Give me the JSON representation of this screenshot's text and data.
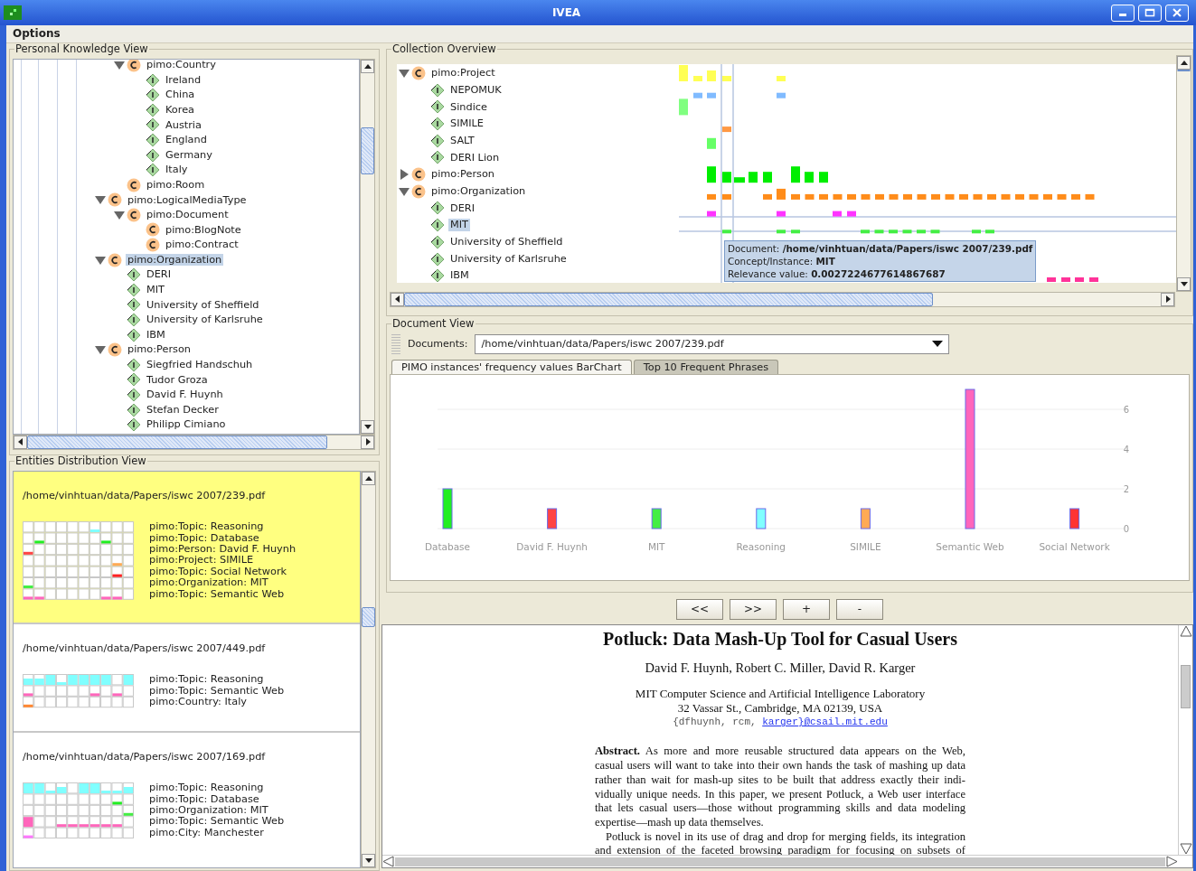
{
  "window": {
    "title": "IVEA"
  },
  "menu": [
    {
      "label": "Options"
    }
  ],
  "knowledge_view": {
    "title": "Personal Knowledge View",
    "tree": [
      {
        "kind": "group",
        "children": [
          {
            "kind": "concept",
            "label": "pimo:Country",
            "expanded": true,
            "selected": false,
            "children": [
              {
                "kind": "instance",
                "label": "Ireland",
                "selected": false
              },
              {
                "kind": "instance",
                "label": "China",
                "selected": false
              },
              {
                "kind": "instance",
                "label": "Korea",
                "selected": false
              },
              {
                "kind": "instance",
                "label": "Austria",
                "selected": false
              },
              {
                "kind": "instance",
                "label": "England",
                "selected": false
              },
              {
                "kind": "instance",
                "label": "Germany",
                "selected": false
              },
              {
                "kind": "instance",
                "label": "Italy",
                "selected": false
              }
            ]
          },
          {
            "kind": "concept",
            "label": "pimo:Room",
            "selected": false
          }
        ]
      },
      {
        "kind": "concept",
        "label": "pimo:LogicalMediaType",
        "expanded": true,
        "selected": false,
        "children": [
          {
            "kind": "concept",
            "label": "pimo:Document",
            "expanded": true,
            "selected": false,
            "children": [
              {
                "kind": "concept",
                "label": "pimo:BlogNote",
                "selected": false
              },
              {
                "kind": "concept",
                "label": "pimo:Contract",
                "selected": false
              }
            ]
          }
        ]
      },
      {
        "kind": "concept",
        "label": "pimo:Organization",
        "expanded": true,
        "selected": true,
        "children": [
          {
            "kind": "instance",
            "label": "DERI",
            "selected": false
          },
          {
            "kind": "instance",
            "label": "MIT",
            "selected": false
          },
          {
            "kind": "instance",
            "label": "University of Sheffield",
            "selected": false
          },
          {
            "kind": "instance",
            "label": "University of Karlsruhe",
            "selected": false
          },
          {
            "kind": "instance",
            "label": "IBM",
            "selected": false
          }
        ]
      },
      {
        "kind": "concept",
        "label": "pimo:Person",
        "expanded": true,
        "selected": false,
        "children": [
          {
            "kind": "instance",
            "label": "Siegfried Handschuh",
            "selected": false
          },
          {
            "kind": "instance",
            "label": "Tudor Groza",
            "selected": false
          },
          {
            "kind": "instance",
            "label": "David F. Huynh",
            "selected": false
          },
          {
            "kind": "instance",
            "label": "Stefan Decker",
            "selected": false
          },
          {
            "kind": "instance",
            "label": "Philipp Cimiano",
            "selected": false
          }
        ]
      }
    ]
  },
  "entities_view": {
    "title": "Entities Distribution View",
    "documents": [
      {
        "path": "/home/vinhtuan/data/Papers/iswc 2007/239.pdf",
        "selected": true,
        "entities": [
          {
            "label": "pimo:Topic: Reasoning",
            "color": "#80ffff"
          },
          {
            "label": "pimo:Topic: Database",
            "color": "#22ee22"
          },
          {
            "label": "pimo:Person: David F. Huynh",
            "color": "#ff4444"
          },
          {
            "label": "pimo:Project: SIMILE",
            "color": "#ffaa55"
          },
          {
            "label": "pimo:Topic: Social Network",
            "color": "#ff2222"
          },
          {
            "label": "pimo:Organization: MIT",
            "color": "#44ee44"
          },
          {
            "label": "pimo:Topic: Semantic Web",
            "color": "#ff66bb"
          }
        ]
      },
      {
        "path": "/home/vinhtuan/data/Papers/iswc 2007/449.pdf",
        "selected": false,
        "entities": [
          {
            "label": "pimo:Topic: Reasoning",
            "color": "#80ffff"
          },
          {
            "label": "pimo:Topic: Semantic Web",
            "color": "#ff66bb"
          },
          {
            "label": "pimo:Country: Italy",
            "color": "#ff8833"
          }
        ]
      },
      {
        "path": "/home/vinhtuan/data/Papers/iswc 2007/169.pdf",
        "selected": false,
        "entities": [
          {
            "label": "pimo:Topic: Reasoning",
            "color": "#80ffff"
          },
          {
            "label": "pimo:Topic: Database",
            "color": "#22ee22"
          },
          {
            "label": "pimo:Organization: MIT",
            "color": "#44ee44"
          },
          {
            "label": "pimo:Topic: Semantic Web",
            "color": "#ff66bb"
          },
          {
            "label": "pimo:City: Manchester",
            "color": "#ff77ff"
          }
        ]
      }
    ]
  },
  "collection_overview": {
    "title": "Collection Overview",
    "tree": [
      {
        "kind": "concept",
        "label": "pimo:Project",
        "expanded": true,
        "selected": false,
        "color": "#ffff55",
        "children": [
          {
            "kind": "instance",
            "label": "NEPOMUK",
            "selected": false,
            "color": "#80bbff"
          },
          {
            "kind": "instance",
            "label": "Sindice",
            "selected": false,
            "color": "#80ff80"
          },
          {
            "kind": "instance",
            "label": "SIMILE",
            "selected": false,
            "color": "#ff9944"
          },
          {
            "kind": "instance",
            "label": "SALT",
            "selected": false,
            "color": "#66ff66"
          },
          {
            "kind": "instance",
            "label": "DERI Lion",
            "selected": false
          }
        ]
      },
      {
        "kind": "concept",
        "label": "pimo:Person",
        "expanded": false,
        "selected": false,
        "color": "#00ee00"
      },
      {
        "kind": "concept",
        "label": "pimo:Organization",
        "expanded": true,
        "selected": false,
        "color": "#ff8c1a",
        "children": [
          {
            "kind": "instance",
            "label": "DERI",
            "selected": false,
            "color": "#ff33ff"
          },
          {
            "kind": "instance",
            "label": "MIT",
            "selected": true,
            "color": "#44ee44"
          },
          {
            "kind": "instance",
            "label": "University of Sheffield",
            "selected": false
          },
          {
            "kind": "instance",
            "label": "University of Karlsruhe",
            "selected": false
          },
          {
            "kind": "instance",
            "label": "IBM",
            "selected": false,
            "color": "#ff3399"
          }
        ]
      }
    ],
    "tooltip": {
      "lines": [
        "Document: **/home/vinhtuan/data/Papers/iswc 2007/239.pdf**",
        "Concept/Instance: **MIT**",
        "Relevance value: **0.0027224677614867687**"
      ]
    }
  },
  "document_view": {
    "title": "Document View",
    "documents_label": "Documents:",
    "document": "/home/vinhtuan/data/Papers/iswc 2007/239.pdf",
    "tabs": [
      {
        "label": "PIMO instances' frequency values BarChart",
        "selected": true
      },
      {
        "label": "Top 10 Frequent Phrases",
        "selected": false
      }
    ],
    "chart_data": {
      "type": "bar",
      "grid": true,
      "ylim": [
        0,
        7
      ],
      "yticks": [
        0,
        2,
        4,
        6
      ],
      "series": [
        {
          "name": "Database",
          "color": "#22ee22",
          "values": [
            2,
            null,
            null,
            null,
            null,
            null,
            null
          ]
        },
        {
          "name": "David F. Huynh",
          "color": "#ff4444",
          "values": [
            null,
            1,
            null,
            null,
            null,
            null,
            null
          ]
        },
        {
          "name": "MIT",
          "color": "#44ee44",
          "values": [
            null,
            null,
            1,
            null,
            null,
            null,
            null
          ]
        },
        {
          "name": "Reasoning",
          "color": "#80ffff",
          "values": [
            null,
            null,
            null,
            1,
            null,
            null,
            null
          ]
        },
        {
          "name": "SIMILE",
          "color": "#ffaa55",
          "values": [
            null,
            null,
            null,
            null,
            1,
            null,
            null
          ]
        },
        {
          "name": "Semantic Web",
          "color": "#ff66bb",
          "values": [
            null,
            null,
            null,
            null,
            null,
            7,
            null
          ]
        },
        {
          "name": "Social Network",
          "color": "#ff3333",
          "values": [
            null,
            null,
            null,
            null,
            null,
            null,
            1
          ]
        }
      ]
    }
  },
  "nav_buttons": [
    {
      "label": "<<"
    },
    {
      "label": ">>"
    },
    {
      "label": "+"
    },
    {
      "label": "-"
    }
  ],
  "paper": {
    "title": "Potluck: Data Mash-Up Tool for Casual Users",
    "authors": "David F. Huynh, Robert C. Miller, David R. Karger",
    "affiliation": [
      "MIT Computer Science and Artificial Intelligence Laboratory",
      "32 Vassar St., Cambridge, MA 02139, USA"
    ],
    "email": {
      "text": "{dfhuynh, rcm, ",
      "link": "karger}@csail.mit.edu"
    },
    "paragraphs": [
      {
        "lines": [
          "**Abstract.** As more and more reusable structured data appears on the Web,",
          "casual users will want to take into their own hands the task of mashing up data",
          "rather than wait for mash-up sites to be built that address exactly their indi-",
          "vidually unique needs. In this paper, we present Potluck, a Web user interface",
          "that lets casual users—those without programming skills and data modeling",
          "expertise—mash up data themselves."
        ]
      },
      {
        "lines": [
          "Potluck is novel in its use of drag and drop for merging fields, its integration",
          "and extension of the faceted browsing paradigm for focusing on subsets of"
        ]
      }
    ]
  }
}
